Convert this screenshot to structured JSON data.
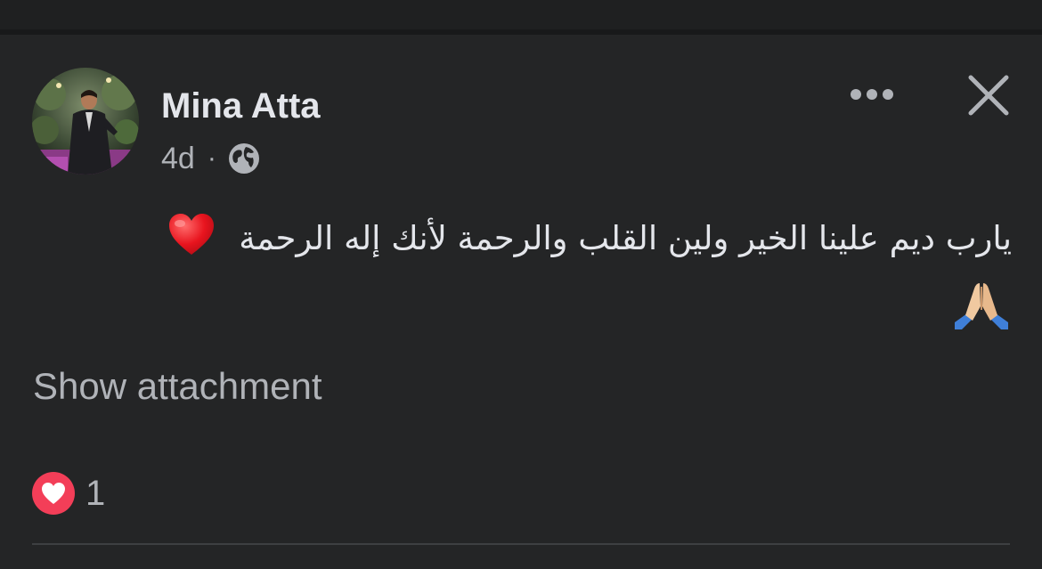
{
  "post": {
    "author_name": "Mina Atta",
    "timestamp": "4d",
    "separator": "·",
    "audience_icon": "globe-icon",
    "more_icon": "more-options-icon",
    "close_icon": "close-icon",
    "text": "يارب ديم علينا الخير ولين القلب والرحمة لأنك إله الرحمة",
    "emojis": [
      "heart-emoji",
      "folded-hands-emoji"
    ],
    "show_attachment_label": "Show attachment",
    "reactions": {
      "icon": "love-reaction-icon",
      "count": "1"
    }
  },
  "colors": {
    "background": "#242526",
    "primary_text": "#e4e6eb",
    "secondary_text": "#b0b3b8",
    "love_reaction": "#f33e58",
    "divider": "#3e4042"
  }
}
